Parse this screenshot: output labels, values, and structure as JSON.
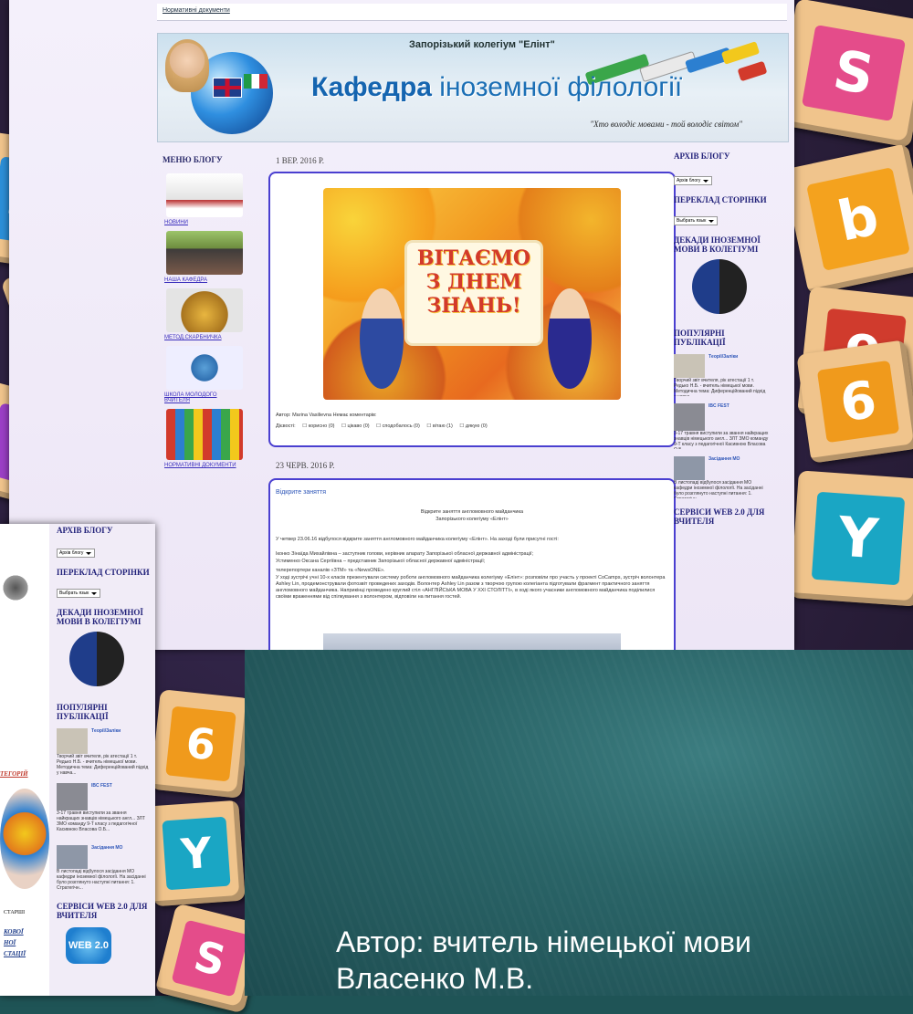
{
  "blog": {
    "top_link": "Нормативні документи",
    "school": "Запорізький колегіум \"Елінт\"",
    "title_part1": "Кафедра",
    "title_part2": "іноземної філології",
    "motto": "\"Хто володіє мовами - той володіє світом\"",
    "menu": {
      "title": "МЕНЮ БЛОГУ",
      "items": [
        "НОВИНИ",
        "НАША КАФЕДРА",
        "МЕТОД.СКАРБНИЧКА",
        "ШКОЛА МОЛОДОГО ВЧИТЕЛЯ",
        "НОРМАТИВНІ ДОКУМЕНТИ"
      ]
    },
    "post1": {
      "date": "1 ВЕР. 2016 Р.",
      "poster_text": "ВІТАЄМО З ДНЕМ ЗНАНЬ!",
      "author_line": "Автор: Marina Vasilievna   Немає коментарів:",
      "reactions_label": "Дієвості:",
      "reactions": [
        "корисно (0)",
        "цікаво (0)",
        "сподобалось (0)",
        "вітаю (1)",
        "дякую (0)"
      ]
    },
    "post2": {
      "date": "23 ЧЕРВ. 2016 Р.",
      "heading": "Відкрите заняття",
      "subheading1": "Відкрите заняття англомовного майданчика",
      "subheading2": "Запорізького колегіуму «Елінт»",
      "paragraph1": "У четвер 23.06.16 відбулося відкрите заняття англомовного майданчика колегіуму «Елінт». На заході були присутні гості:",
      "paragraph2": "Іконко Зінаїда Михайлівна – заступник голови, керівник апарату Запорізької обласної державної адміністрації;",
      "paragraph3": "Устименко Оксана Сергіївна – представник Запорізької обласної державної адміністрації;",
      "paragraph4": "телерепортери каналів «ЗТМ» та «NewsONE».",
      "paragraph5": "У ході зустрічі учні 10-х класів презентували систему роботи англомовного майданчика колегіуму «Елінт»: розповіли про участь у проекті CoCamps, зустріч волонтера Ashley Lin, продемонстрували фотозвіт проведених заходів. Волонтер Ashley Lin разом з творчою групою колегіанта підготували фрагмент практичного заняття англомовного майданчика. Наприкінці проведено круглий стіл «АНГЛІЙСЬКА МОВА У ХХІ СТОЛІТТІ», в ході якого учасники англомовного майданчика поділилися своїми враженнями від спілкування з волонтером, відповіли на питання гостей."
    },
    "sidebar": {
      "archive": "АРХІВ БЛОГУ",
      "archive_select": "Архів блогу",
      "translate": "ПЕРЕКЛАД СТОРІНКИ",
      "translate_select": "Выбрать язык",
      "decades": "ДЕКАДИ ІНОЗЕМНОЇ МОВИ В КОЛЕГІУМІ",
      "popular": "ПОПУЛЯРНІ ПУБЛІКАЦІЇ",
      "pop1_title": "Тeopiї/Залiки",
      "pop1_text": "Творчий звіт вчителя, рiк атестації 1 т. Редько Н.Б. - вчитель німецької мови. Методична тема: Диференційований підхід у навча...",
      "pop2_title": "IBC FEST",
      "pop2_text": "3-17 травня виступили за звання найкращих знавців німецького англ... ЗЛТ ЗМО команду 9-Т класу з педагогічної Касивною Власова О.Б...",
      "pop3_title": "Засідання МО",
      "pop3_text": "В листопаді відбулося засідання МО кафедри іноземної філології. На засіданні було розглянуто наступні питання: 1. Стратегічн...",
      "services": "СЕРВІСИ WEB 2.0 ДЛЯ ВЧИТЕЛЯ",
      "web_badge": "WEB 2.0"
    },
    "second": {
      "archive": "АРХІВ БЛОГУ",
      "archive_select": "Архів блогу",
      "translate": "ПЕРЕКЛАД СТОРІНКИ",
      "translate_select": "Выбрать язык",
      "decades": "ДЕКАДИ ІНОЗЕМНОЇ МОВИ В КОЛЕГІУМІ",
      "popular": "ПОПУЛЯРНІ ПУБЛІКАЦІЇ",
      "services": "СЕРВІСИ WEB 2.0 ДЛЯ ВЧИТЕЛЯ",
      "categories": "ТЕГОРІЙ",
      "older": "СТАРШІ",
      "left_links": [
        "КОВОЇ",
        "НОЇ",
        "СТАЦІЇ"
      ]
    }
  },
  "slide": {
    "line1": "Автор: вчитель німецької мови",
    "line2": "Власенко М.В."
  }
}
